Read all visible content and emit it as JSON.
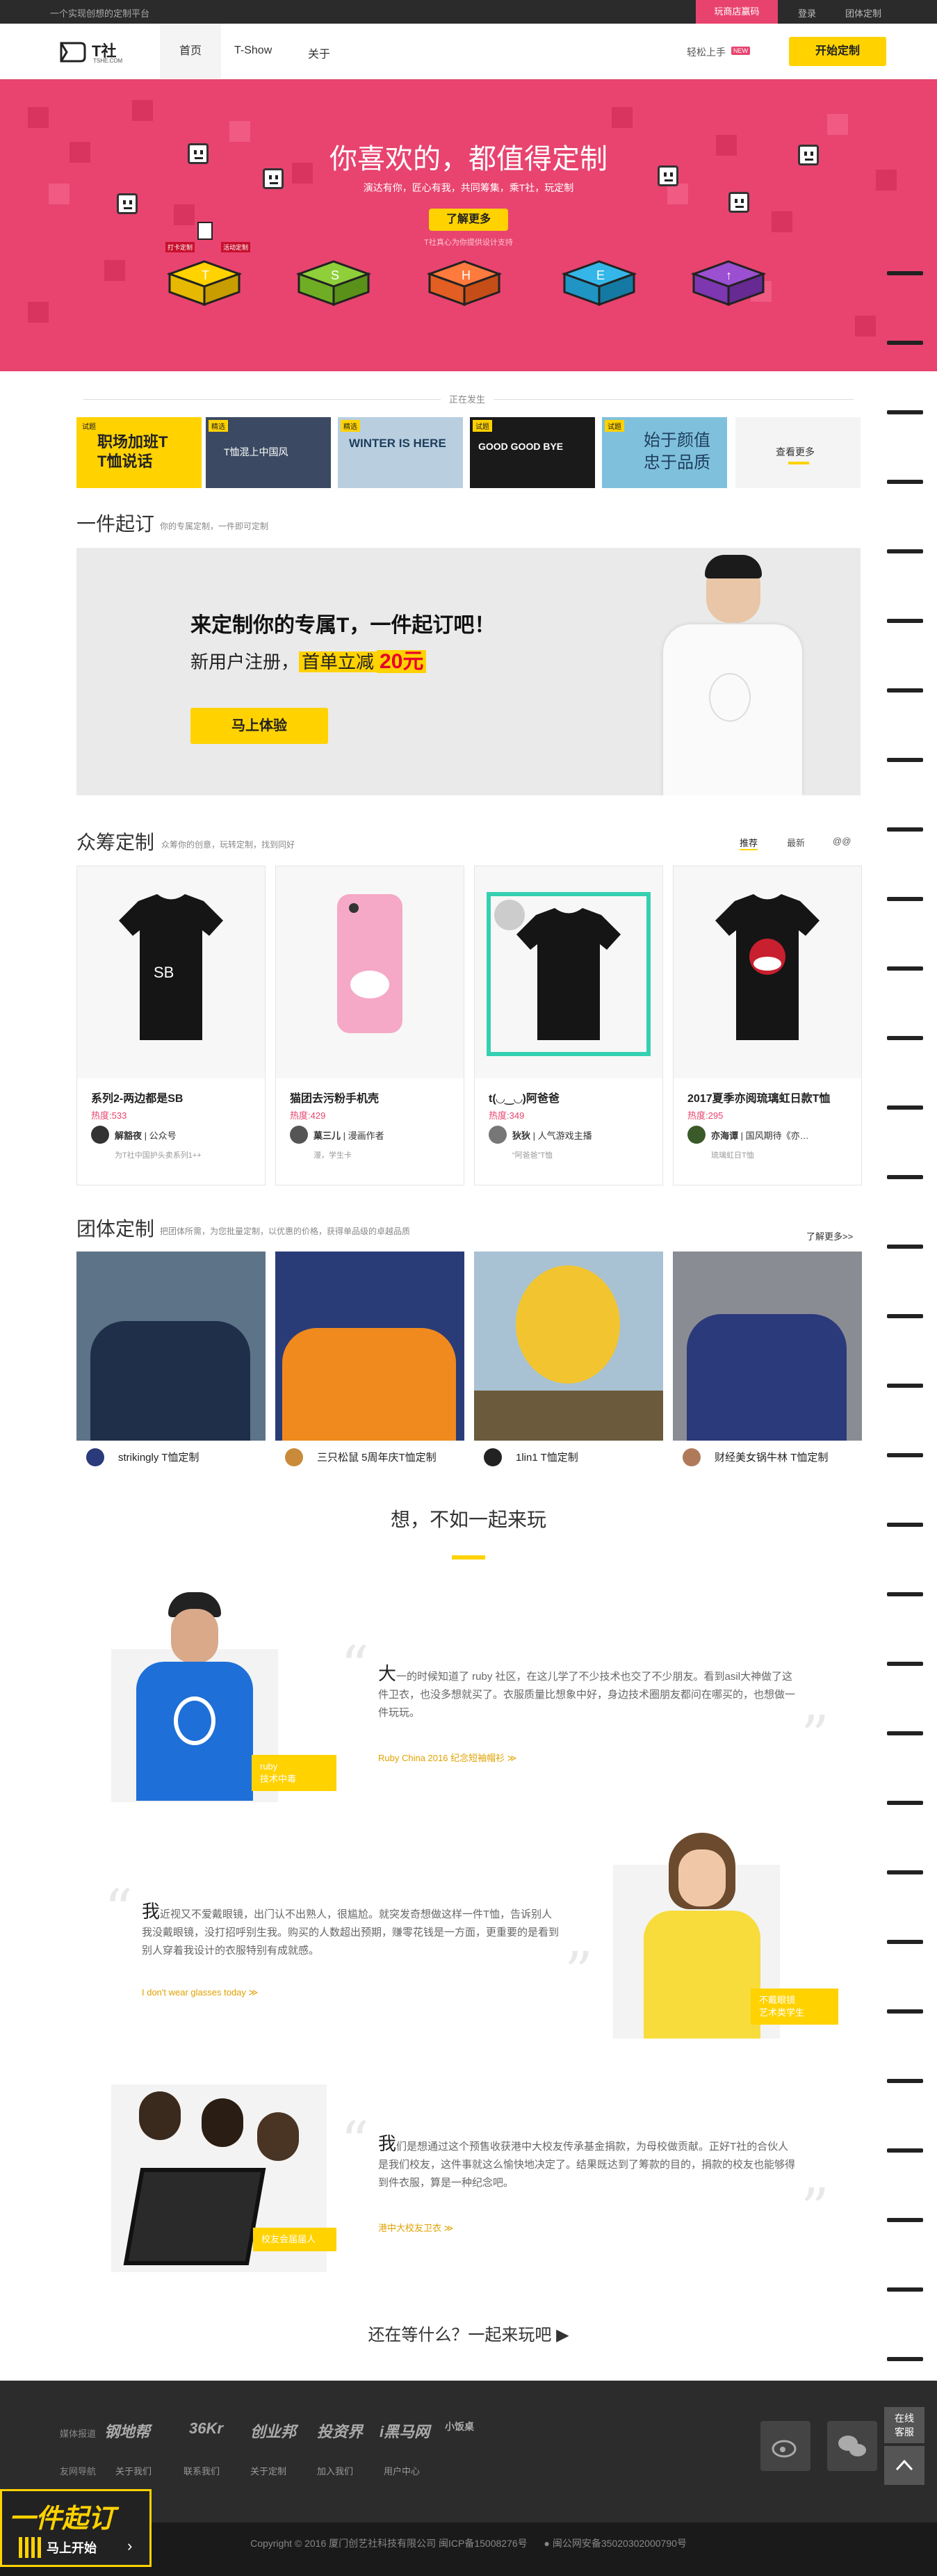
{
  "topbar": {
    "slogan": "一个实现创想的定制平台",
    "promo": "玩商店赢码",
    "login": "登录",
    "team": "团体定制"
  },
  "nav": {
    "items": [
      "首页",
      "T-Show",
      "关于"
    ],
    "easy": "轻松上手",
    "new_badge": "NEW",
    "start": "开始定制",
    "logo_text": "T社",
    "logo_sub": "TSHE.COM"
  },
  "hero": {
    "title": "你喜欢的，都值得定制",
    "subtitle": "演达有你，匠心有我，共同筹集，乘T社，玩定制",
    "more": "了解更多",
    "small": "T社真心为你提供设计支持",
    "tags": [
      "打卡定制",
      "活动定制"
    ],
    "shirt_letters": [
      "T",
      "S",
      "H",
      "E",
      "↑"
    ]
  },
  "happening": {
    "label": "正在发生",
    "items": [
      {
        "tag": "试题",
        "text": "职场加班T\nT恤说话"
      },
      {
        "tag": "精选",
        "text": "T恤混上中国风"
      },
      {
        "tag": "精选",
        "text": "WINTER IS HERE"
      },
      {
        "tag": "试题",
        "text": "GOOD GOOD BYE"
      },
      {
        "tag": "试题",
        "text": "始于颜值\n忠于品质"
      }
    ],
    "more": "查看更多"
  },
  "one": {
    "title": "一件起订",
    "desc": "你的专属定制，一件即可定制",
    "headline": "来定制你的专属T，一件起订吧！",
    "line2a": "新用户注册，",
    "line2b": "首单立减",
    "line2c": "20元",
    "btn": "马上体验"
  },
  "crowd": {
    "title": "众筹定制",
    "desc": "众筹你的创意，玩转定制，找到同好",
    "tabs": [
      "推荐",
      "最新",
      "@@"
    ],
    "cards": [
      {
        "name": "系列2-两边都是SB",
        "hot": "热度:533",
        "author": "解豁夜",
        "role": "公众号",
        "desc": "为T社中国护头卖系列1++"
      },
      {
        "name": "猫团去污粉手机壳",
        "hot": "热度:429",
        "author": "菓三儿",
        "role": "漫画作者",
        "desc": "漫，学生卡"
      },
      {
        "name": "t(◡‿◡)阿爸爸",
        "hot": "热度:349",
        "author": "狄狄",
        "role": "人气游戏主播",
        "desc": "“阿爸爸”T恤"
      },
      {
        "name": "2017夏季亦阅琉璃虹日款T恤",
        "hot": "热度:295",
        "author": "亦海谭",
        "role": "国风期待《亦…",
        "desc": "琉璃虹日T恤"
      }
    ]
  },
  "team": {
    "title": "团体定制",
    "desc": "把团体所需，为您批量定制，以优惠的价格，获得单品级的卓越品质",
    "more": "了解更多>>",
    "items": [
      {
        "cap": "strikingly T恤定制"
      },
      {
        "cap": "三只松鼠 5周年庆T恤定制"
      },
      {
        "cap": "1lin1 T恤定制"
      },
      {
        "cap": "财经美女锅牛林 T恤定制"
      }
    ]
  },
  "stories": {
    "title": "想，不如一起来玩",
    "s1": {
      "big": "大",
      "text": "一的时候知道了 ruby 社区，在这儿学了不少技术也交了不少朋友。看到asil大神做了这件卫衣，也没多想就买了。衣服质量比想象中好，身边技术圈朋友都问在哪买的，也想做一件玩玩。",
      "link": "Ruby China 2016 纪念短袖帽衫 ≫",
      "name": "ruby",
      "role": "技术中毒"
    },
    "s2": {
      "big": "我",
      "text": "近视又不爱戴眼镜，出门认不出熟人，很尴尬。就突发奇想做这样一件T恤，告诉别人我没戴眼镜，没打招呼别生我。购买的人数超出预期，赚零花钱是一方面，更重要的是看到别人穿着我设计的衣服特别有成就感。",
      "link": "I don't wear glasses today ≫",
      "name": "不戴眼镜",
      "role": "艺术类学生"
    },
    "s3": {
      "big": "我",
      "text": "们是想通过这个预售收获港中大校友传承基金捐款，为母校做贡献。正好T社的合伙人是我们校友，这件事就这么愉快地决定了。结果既达到了筹款的目的，捐款的校友也能够得到件衣服，算是一种纪念吧。",
      "link": "港中大校友卫衣 ≫",
      "name": "校友会届届人"
    }
  },
  "cta": {
    "text": "还在等什么？一起来玩吧 ▶"
  },
  "footer": {
    "media_label": "媒体报道",
    "partners": [
      "钢地帮",
      "36Kr",
      "创业邦",
      "投资界",
      "i黑马网",
      "小饭桌"
    ],
    "links_label": "友网导航",
    "links": [
      "关于我们",
      "联系我们",
      "关于定制",
      "加入我们",
      "用户中心"
    ],
    "online": "在线\n客服",
    "copyright": "Copyright © 2016 厦门创艺社科技有限公司   闽ICP备15008276号",
    "police": "闽公网安备35020302000790号"
  },
  "float": {
    "line1": "一件起订",
    "line2": "马上开始"
  }
}
